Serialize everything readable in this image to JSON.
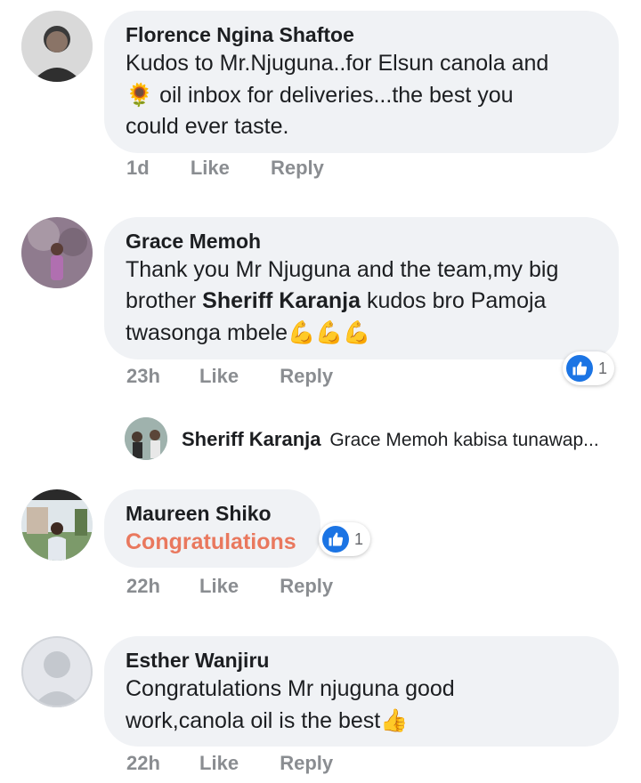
{
  "comments": [
    {
      "author": "Florence Ngina Shaftoe",
      "text_line1": "Kudos to Mr.Njuguna..for Elsun canola and",
      "text_line2_emoji": "🌻",
      "text_line2": " oil inbox for deliveries...the best you",
      "text_line3": "could ever taste.",
      "time": "1d",
      "like_label": "Like",
      "reply_label": "Reply"
    },
    {
      "author": "Grace Memoh",
      "text_line1": "Thank you Mr Njuguna and the team,my big",
      "text_line2_pre": "brother ",
      "mention": "Sheriff Karanja",
      "text_line2_post": " kudos bro Pamoja",
      "text_line3": "twasonga mbele",
      "text_line3_emoji": "💪💪💪",
      "reaction_count": "1",
      "time": "23h",
      "like_label": "Like",
      "reply_label": "Reply",
      "reply": {
        "author": "Sheriff Karanja",
        "preview": "Grace Memoh kabisa tunawap..."
      }
    },
    {
      "author": "Maureen Shiko",
      "text": "Congratulations",
      "reaction_count": "1",
      "time": "22h",
      "like_label": "Like",
      "reply_label": "Reply"
    },
    {
      "author": "Esther Wanjiru",
      "text_line1": "Congratulations Mr njuguna good",
      "text_line2": "work,canola oil is the best",
      "text_line2_emoji": "👍",
      "time": "22h",
      "like_label": "Like",
      "reply_label": "Reply"
    }
  ],
  "colors": {
    "bubble": "#f0f2f5",
    "meta": "#8a8d91",
    "like_blue": "#1b74e4",
    "congrats": "#e9785e"
  }
}
